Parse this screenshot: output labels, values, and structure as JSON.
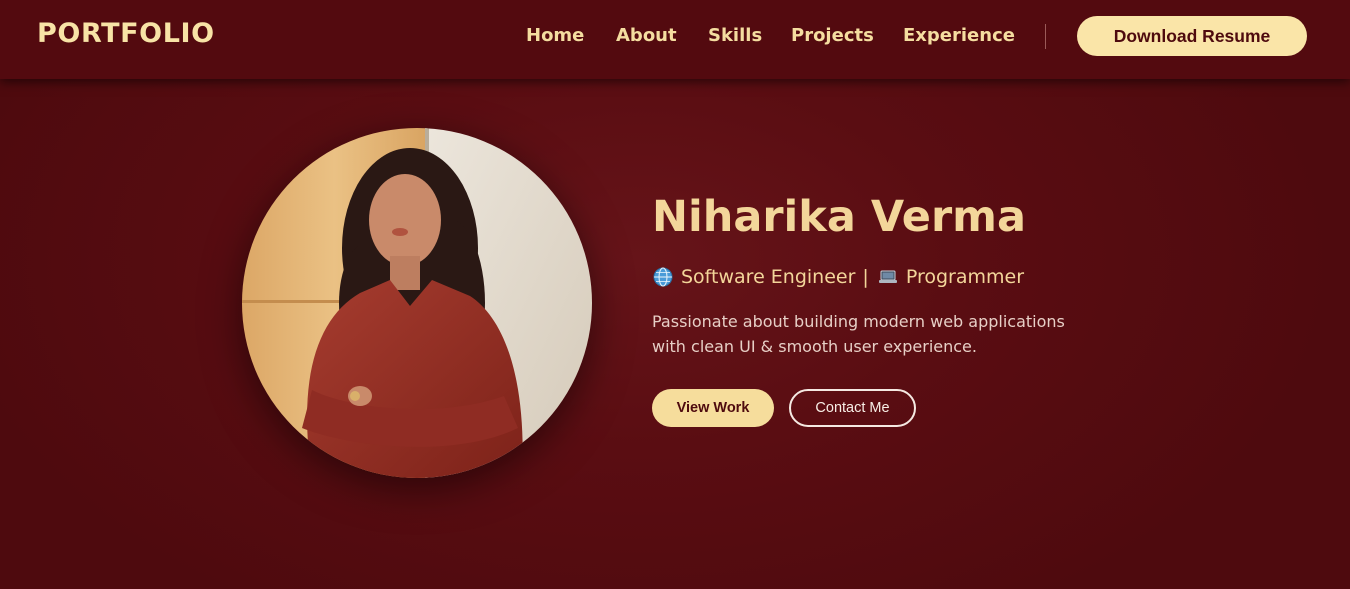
{
  "header": {
    "brand": "PORTFOLIO",
    "nav": [
      "Home",
      "About",
      "Skills",
      "Projects",
      "Experience"
    ],
    "resume_button": "Download Resume"
  },
  "hero": {
    "name": "Niharika Verma",
    "roles": [
      {
        "icon": "globe-icon",
        "label": "Software Engineer"
      },
      {
        "icon": "laptop-icon",
        "label": "Programmer"
      }
    ],
    "role_separator": "|",
    "tagline_line1": "Passionate about building modern web applications",
    "tagline_line2": "with clean UI & smooth user experience.",
    "primary_button": "View Work",
    "secondary_button": "Contact Me"
  },
  "colors": {
    "background": "#540b10",
    "header": "#530a0f",
    "accent": "#f6dd9c",
    "text_light": "#e7cfc6"
  }
}
